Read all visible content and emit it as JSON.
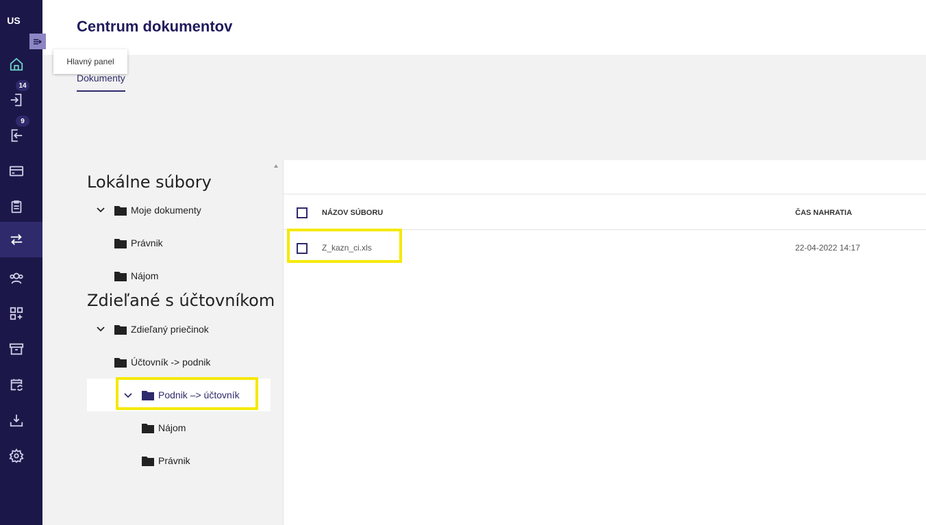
{
  "user": {
    "initials": "US"
  },
  "nav": {
    "toggle_icon": "expand-icon",
    "items": [
      {
        "icon": "home-icon",
        "active": false
      },
      {
        "icon": "import-icon",
        "badge": "14"
      },
      {
        "icon": "export-icon",
        "badge": "9"
      },
      {
        "icon": "card-icon"
      },
      {
        "icon": "clipboard-icon"
      },
      {
        "icon": "transfer-icon",
        "active": true
      },
      {
        "icon": "users-icon"
      },
      {
        "icon": "apps-add-icon"
      },
      {
        "icon": "archive-icon"
      },
      {
        "icon": "calendar-sync-icon"
      },
      {
        "icon": "download-icon"
      },
      {
        "icon": "settings-icon"
      }
    ]
  },
  "tooltip": "Hlavný panel",
  "header": {
    "title": "Centrum dokumentov"
  },
  "tabs": [
    {
      "label": "Dokumenty",
      "active": true
    }
  ],
  "tree": {
    "local_heading": "Lokálne súbory",
    "local": [
      {
        "label": "Moje dokumenty",
        "expanded": true
      },
      {
        "label": "Právnik"
      },
      {
        "label": "Nájom"
      }
    ],
    "shared_heading": "Zdieľané s účtovníkom",
    "shared": [
      {
        "label": "Zdieľaný priečinok",
        "expanded": true
      },
      {
        "label": "Účtovník -> podnik"
      },
      {
        "label": "Podnik –> účtovník",
        "expanded": true,
        "selected": true
      },
      {
        "label": "Nájom"
      },
      {
        "label": "Právnik"
      }
    ]
  },
  "files": {
    "columns": {
      "name": "NÁZOV SÚBORU",
      "time": "ČAS NAHRATIA"
    },
    "rows": [
      {
        "name": "Z_kazn_ci.xls",
        "uploaded": "22-04-2022 14:17"
      }
    ]
  },
  "colors": {
    "nav_bg": "#1b1849",
    "accent": "#2e2a6b",
    "highlight": "#f5e900",
    "home_icon": "#6fd3c6"
  }
}
